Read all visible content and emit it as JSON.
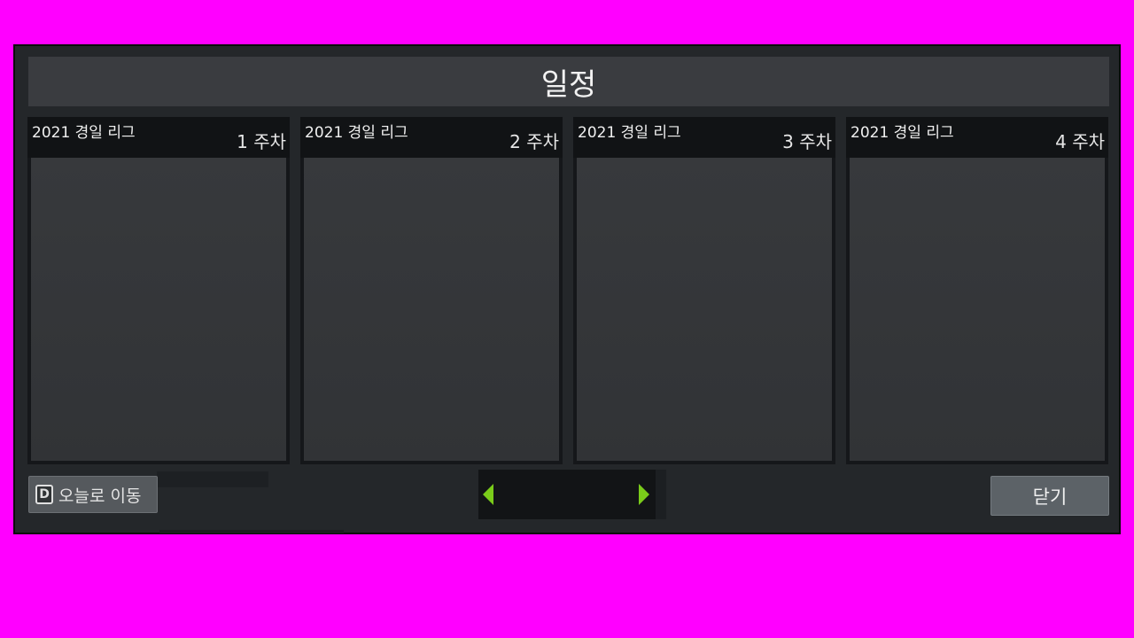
{
  "window": {
    "title": "일정"
  },
  "weeks": [
    {
      "league": "2021 경일 리그",
      "week": "1 주차"
    },
    {
      "league": "2021 경일 리그",
      "week": "2 주차"
    },
    {
      "league": "2021 경일 리그",
      "week": "3 주차"
    },
    {
      "league": "2021 경일 리그",
      "week": "4 주차"
    }
  ],
  "footer": {
    "today_key": "D",
    "today_label": "오늘로 이동",
    "close_label": "닫기",
    "prev_icon": "triangle-left-icon",
    "next_icon": "triangle-right-icon"
  },
  "colors": {
    "background": "#ff00ff",
    "arrow_accent": "#7acc1a"
  }
}
